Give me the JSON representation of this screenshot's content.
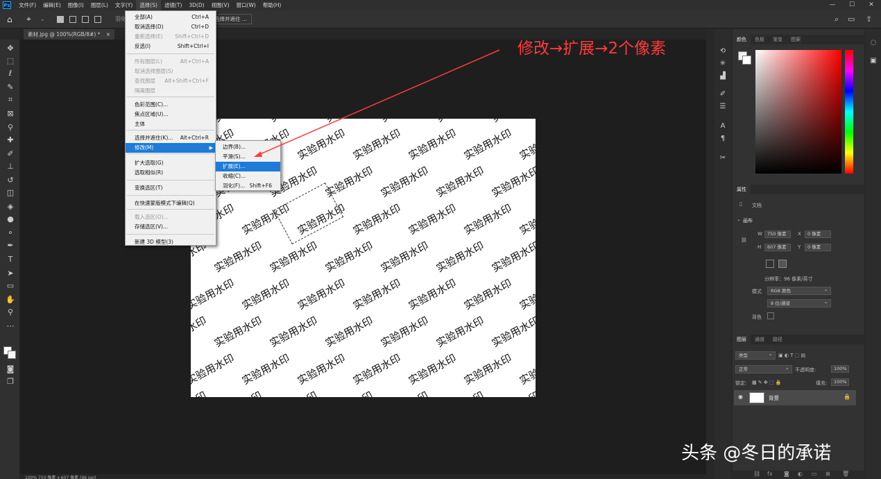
{
  "menubar": {
    "items": [
      "文件(F)",
      "编辑(E)",
      "图像(I)",
      "图层(L)",
      "文字(Y)",
      "选择(S)",
      "滤镜(T)",
      "3D(D)",
      "视图(V)",
      "窗口(W)",
      "帮助(H)"
    ],
    "active_index": 5
  },
  "optbar": {
    "feather_label": "羽化",
    "mask_button": "选择并遮住 ..."
  },
  "tab": {
    "title": "素材.jpg @ 100%(RGB/8#) *",
    "close": "×"
  },
  "select_menu": {
    "items": [
      {
        "label": "全部(A)",
        "shortcut": "Ctrl+A",
        "disabled": false
      },
      {
        "label": "取消选择(D)",
        "shortcut": "Ctrl+D",
        "disabled": false
      },
      {
        "label": "重新选择(E)",
        "shortcut": "Shift+Ctrl+D",
        "disabled": true
      },
      {
        "label": "反选(I)",
        "shortcut": "Shift+Ctrl+I",
        "disabled": false
      },
      {
        "label": "所有图层(L)",
        "shortcut": "Alt+Ctrl+A",
        "disabled": true
      },
      {
        "label": "取消选择图层(S)",
        "shortcut": "",
        "disabled": true
      },
      {
        "label": "查找图层",
        "shortcut": "Alt+Shift+Ctrl+F",
        "disabled": true
      },
      {
        "label": "隔离图层",
        "shortcut": "",
        "disabled": true
      },
      {
        "label": "色彩范围(C)...",
        "shortcut": "",
        "disabled": false
      },
      {
        "label": "焦点区域(U)...",
        "shortcut": "",
        "disabled": false
      },
      {
        "label": "主体",
        "shortcut": "",
        "disabled": false
      },
      {
        "label": "选择并遮住(K)...",
        "shortcut": "Alt+Ctrl+R",
        "disabled": false
      },
      {
        "label": "修改(M)",
        "shortcut": "",
        "disabled": false
      },
      {
        "label": "扩大选取(G)",
        "shortcut": "",
        "disabled": false
      },
      {
        "label": "选取相似(R)",
        "shortcut": "",
        "disabled": false
      },
      {
        "label": "变换选区(T)",
        "shortcut": "",
        "disabled": false
      },
      {
        "label": "在快速蒙版模式下编辑(Q)",
        "shortcut": "",
        "disabled": false
      },
      {
        "label": "载入选区(O)...",
        "shortcut": "",
        "disabled": true
      },
      {
        "label": "存储选区(V)...",
        "shortcut": "",
        "disabled": false
      },
      {
        "label": "新建 3D 模型(3)",
        "shortcut": "",
        "disabled": false
      }
    ]
  },
  "modify_submenu": {
    "items": [
      {
        "label": "边界(B)...",
        "shortcut": ""
      },
      {
        "label": "平滑(S)...",
        "shortcut": ""
      },
      {
        "label": "扩展(E)...",
        "shortcut": ""
      },
      {
        "label": "收缩(C)...",
        "shortcut": ""
      },
      {
        "label": "羽化(F)...",
        "shortcut": "Shift+F6"
      }
    ],
    "highlighted_index": 2
  },
  "canvas": {
    "watermark_text": "实验用水印"
  },
  "annotation": "修改→扩展→2个像素",
  "panels": {
    "color_tabs": [
      "颜色",
      "色板",
      "渐变",
      "图案"
    ],
    "properties_tab": "属性",
    "doc_label": "文档",
    "canvas_label": "画布",
    "w_label": "W",
    "w_value": "750 像素",
    "h_label": "H",
    "h_value": "607 像素",
    "x_label": "X",
    "x_value": "0 像素",
    "y_label": "Y",
    "y_value": "0 像素",
    "resolution": "分辨率：96 像素/英寸",
    "mode_label": "模式",
    "mode_value": "RGB 颜色",
    "depth_value": "8 位/通道",
    "bg_label": "背色",
    "layer_tabs": [
      "图层",
      "通道",
      "路径"
    ],
    "kind_label": "类型",
    "blend_mode": "正常",
    "opacity_label": "不透明度:",
    "opacity_value": "100%",
    "lock_label": "锁定:",
    "fill_label": "填充:",
    "fill_value": "100%",
    "layer_name": "背景"
  },
  "status": "100%     750 像素 x 607 像素 (96 ppi)",
  "source_watermark": "头条 @冬日的承诺",
  "colors": {
    "menu_highlight": "#1e7bd7",
    "annotation": "#ff3a3a"
  }
}
